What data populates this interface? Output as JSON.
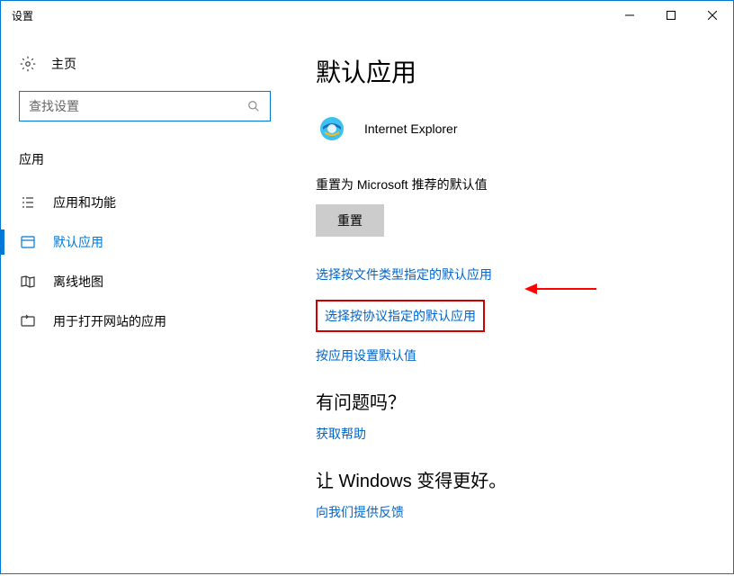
{
  "window": {
    "title": "设置"
  },
  "sidebar": {
    "home_label": "主页",
    "search_placeholder": "查找设置",
    "section_title": "应用",
    "items": [
      {
        "label": "应用和功能"
      },
      {
        "label": "默认应用"
      },
      {
        "label": "离线地图"
      },
      {
        "label": "用于打开网站的应用"
      }
    ]
  },
  "main": {
    "title": "默认应用",
    "app_name": "Internet Explorer",
    "reset_label": "重置为 Microsoft 推荐的默认值",
    "reset_button": "重置",
    "links": {
      "by_filetype": "选择按文件类型指定的默认应用",
      "by_protocol": "选择按协议指定的默认应用",
      "by_app": "按应用设置默认值"
    },
    "help": {
      "heading": "有问题吗？",
      "link": "获取帮助"
    },
    "feedback": {
      "heading": "让 Windows 变得更好。",
      "link": "向我们提供反馈"
    }
  }
}
